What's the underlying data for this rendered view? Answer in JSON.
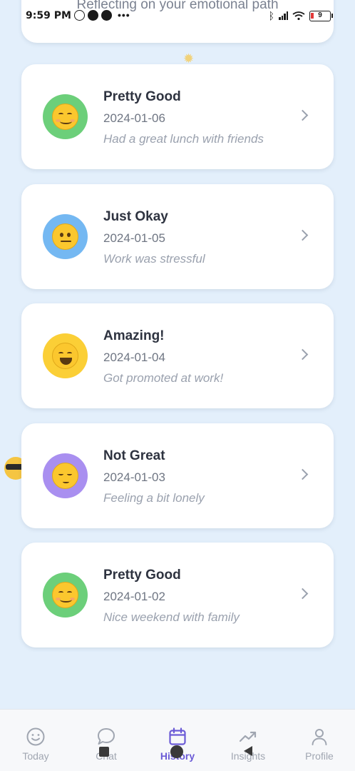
{
  "status_bar": {
    "time": "9:59 PM",
    "battery": "9"
  },
  "header": {
    "subtitle": "Reflecting on your emotional path"
  },
  "entries": [
    {
      "title": "Pretty Good",
      "date": "2024-01-06",
      "note": "Had a great lunch with friends",
      "mood": "smile",
      "color": "#6ccf7a"
    },
    {
      "title": "Just Okay",
      "date": "2024-01-05",
      "note": "Work was stressful",
      "mood": "neutral",
      "color": "#74b8f2"
    },
    {
      "title": "Amazing!",
      "date": "2024-01-04",
      "note": "Got promoted at work!",
      "mood": "grin",
      "color": "#fbcf36"
    },
    {
      "title": "Not Great",
      "date": "2024-01-03",
      "note": "Feeling a bit lonely",
      "mood": "pensive",
      "color": "#a98ff0"
    },
    {
      "title": "Pretty Good",
      "date": "2024-01-02",
      "note": "Nice weekend with family",
      "mood": "smile",
      "color": "#6ccf7a"
    }
  ],
  "nav": {
    "items": [
      {
        "label": "Today",
        "icon": "smiley-icon"
      },
      {
        "label": "Chat",
        "icon": "chat-bubble-icon"
      },
      {
        "label": "History",
        "icon": "calendar-icon"
      },
      {
        "label": "Insights",
        "icon": "trend-up-icon"
      },
      {
        "label": "Profile",
        "icon": "person-icon"
      }
    ],
    "active": "History"
  },
  "colors": {
    "background": "#e3effb",
    "card": "#ffffff",
    "accent": "#6b5bd6",
    "muted_text": "#9aa1ae"
  }
}
